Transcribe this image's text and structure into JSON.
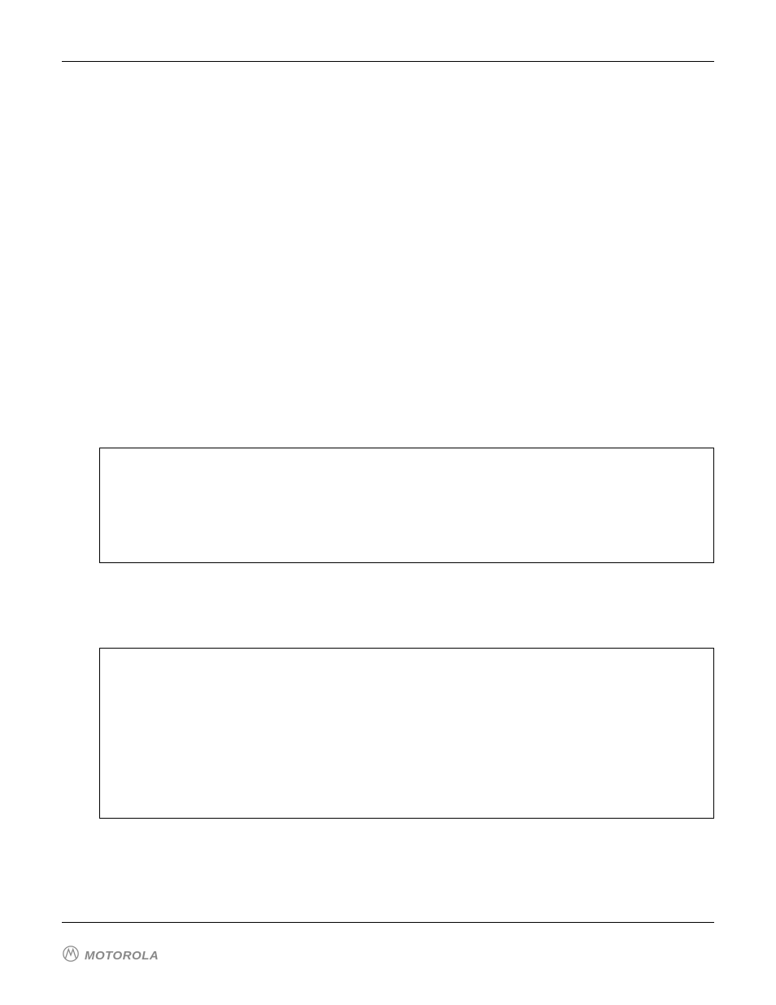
{
  "footer": {
    "brand_icon": "motorola-logo",
    "brand_text": "MOTOROLA"
  },
  "boxes": {
    "box1": "",
    "box2": ""
  }
}
